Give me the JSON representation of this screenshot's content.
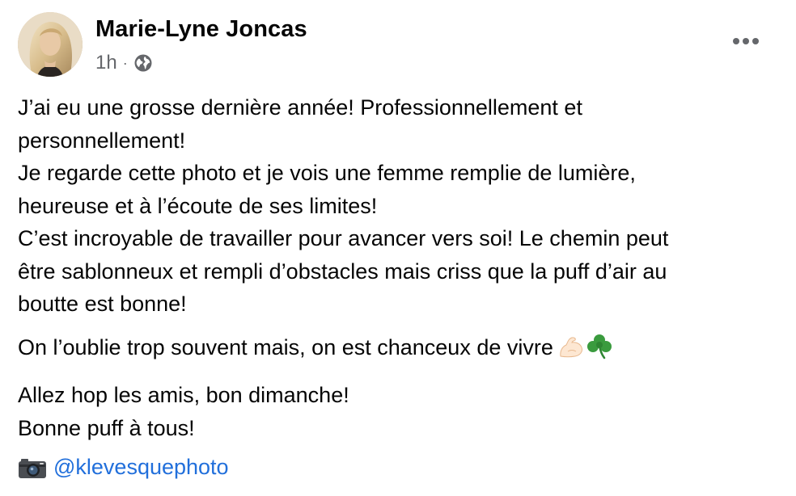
{
  "post": {
    "author_name": "Marie-Lyne Joncas",
    "timestamp": "1h",
    "separator": "·",
    "privacy_icon": "globe-icon",
    "more_icon": "more-options-icon",
    "paragraphs": [
      {
        "lines": [
          "J’ai eu une grosse dernière année! Professionnellement et",
          "personnellement!",
          "Je regarde cette photo et je vois une femme remplie de lumière,",
          "heureuse et à l’écoute de ses limites!",
          "C’est incroyable de travailler pour avancer vers soi! Le chemin peut",
          "être sablonneux et rempli d’obstacles mais criss que la puff d’air au",
          "boutte est bonne!"
        ]
      },
      {
        "lines": [
          "On l’oublie trop souvent mais, on est chanceux de vivre"
        ],
        "emojis": [
          "flexed-biceps-emoji",
          "shamrock-emoji"
        ]
      },
      {
        "lines": [
          "Allez hop les amis, bon dimanche!",
          "Bonne puff à tous!"
        ]
      }
    ],
    "credit_icon": "camera-emoji",
    "credit_link": "@klevesquephoto",
    "colors": {
      "text": "#050505",
      "secondary": "#65676b",
      "link": "#216fdb"
    }
  }
}
